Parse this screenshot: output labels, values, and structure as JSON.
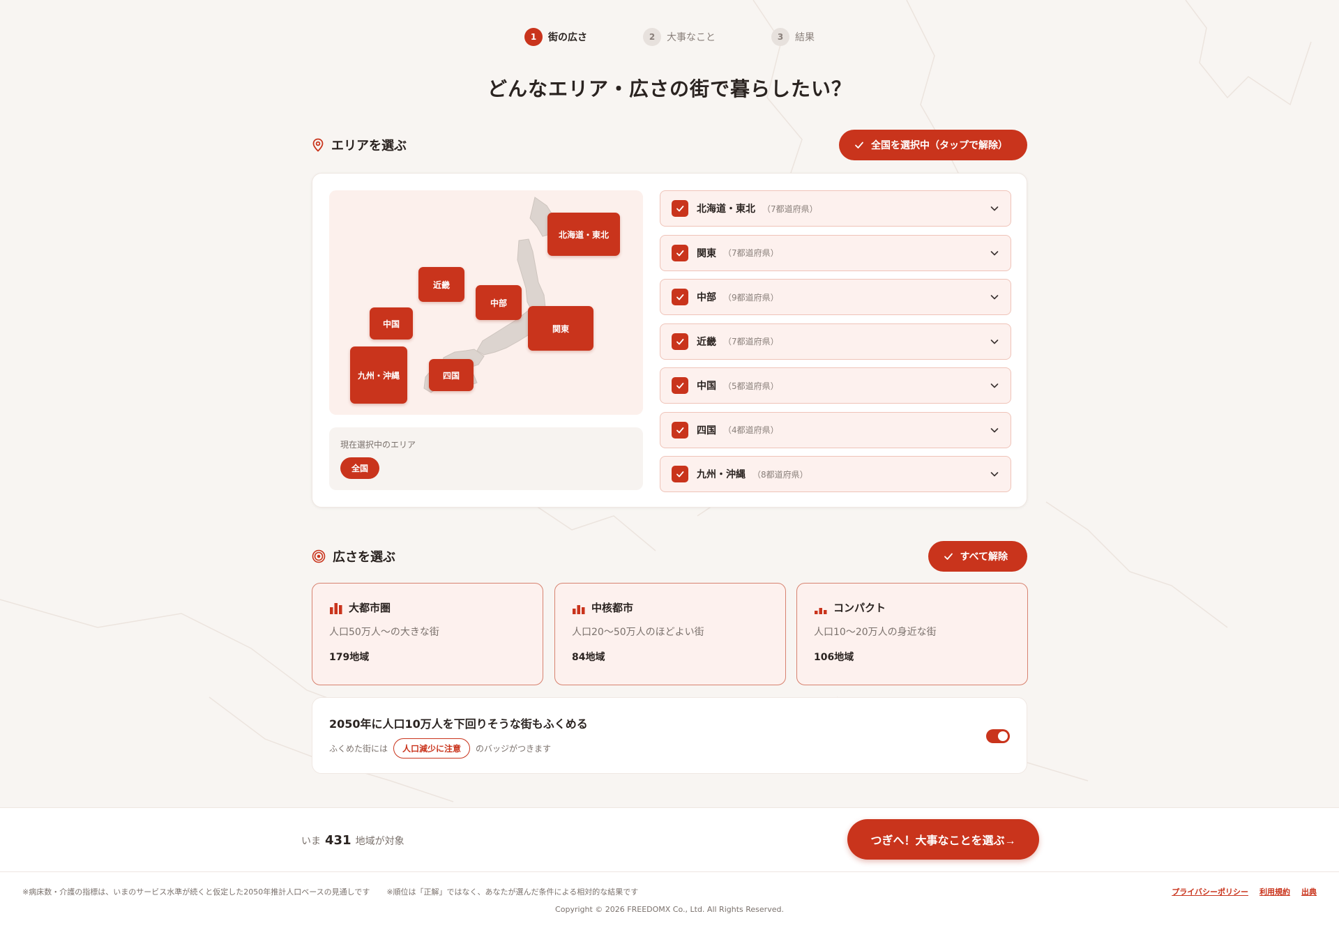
{
  "stepper": [
    {
      "num": "1",
      "label": "街の広さ"
    },
    {
      "num": "2",
      "label": "大事なこと"
    },
    {
      "num": "3",
      "label": "結果"
    }
  ],
  "page_title": "どんなエリア・広さの街で暮らしたい？",
  "area": {
    "heading": "エリアを選ぶ",
    "select_all_label": "全国を選択中（タップで解除）",
    "map_chips": [
      "北海道・東北",
      "近畿",
      "中部",
      "中国",
      "関東",
      "九州・沖縄",
      "四国"
    ],
    "current_caption": "現在選択中のエリア",
    "current_value": "全国",
    "regions": [
      {
        "name": "北海道・東北",
        "count": "（7都道府県）"
      },
      {
        "name": "関東",
        "count": "（7都道府県）"
      },
      {
        "name": "中部",
        "count": "（9都道府県）"
      },
      {
        "name": "近畿",
        "count": "（7都道府県）"
      },
      {
        "name": "中国",
        "count": "（5都道府県）"
      },
      {
        "name": "四国",
        "count": "（4都道府県）"
      },
      {
        "name": "九州・沖縄",
        "count": "（8都道府県）"
      }
    ]
  },
  "size": {
    "heading": "広さを選ぶ",
    "clear_label": "すべて解除",
    "options": [
      {
        "title": "大都市圏",
        "desc": "人口50万人〜の大きな街",
        "count": "179地域"
      },
      {
        "title": "中核都市",
        "desc": "人口20〜50万人のほどよい街",
        "count": "84地域"
      },
      {
        "title": "コンパクト",
        "desc": "人口10〜20万人の身近な街",
        "count": "106地域"
      }
    ]
  },
  "toggle": {
    "title": "2050年に人口10万人を下回りそうな街もふくめる",
    "sub_before": "ふくめた街には",
    "badge": "人口減少に注意",
    "sub_after": "のバッジがつきます"
  },
  "bottom": {
    "prefix": "いま",
    "count": "431",
    "suffix": "地域が対象",
    "next_label": "つぎへ！大事なことを選ぶ→"
  },
  "footer": {
    "note1": "※病床数・介護の指標は、いまのサービス水準が続くと仮定した2050年推計人口ベースの見通しです",
    "note2": "※順位は「正解」ではなく、あなたが選んだ条件による相対的な結果です",
    "links": [
      "プライバシーポリシー",
      "利用規約",
      "出典"
    ],
    "copyright": "Copyright © 2026 FREEDOMX Co., Ltd. All Rights Reserved."
  },
  "colors": {
    "accent": "#c9341c",
    "bg": "#f8f5f2",
    "card_tint": "#fdf1ee"
  },
  "icons": [
    "pin-icon",
    "check-icon",
    "chevron-down-icon",
    "target-icon",
    "bar-chart-icon"
  ]
}
